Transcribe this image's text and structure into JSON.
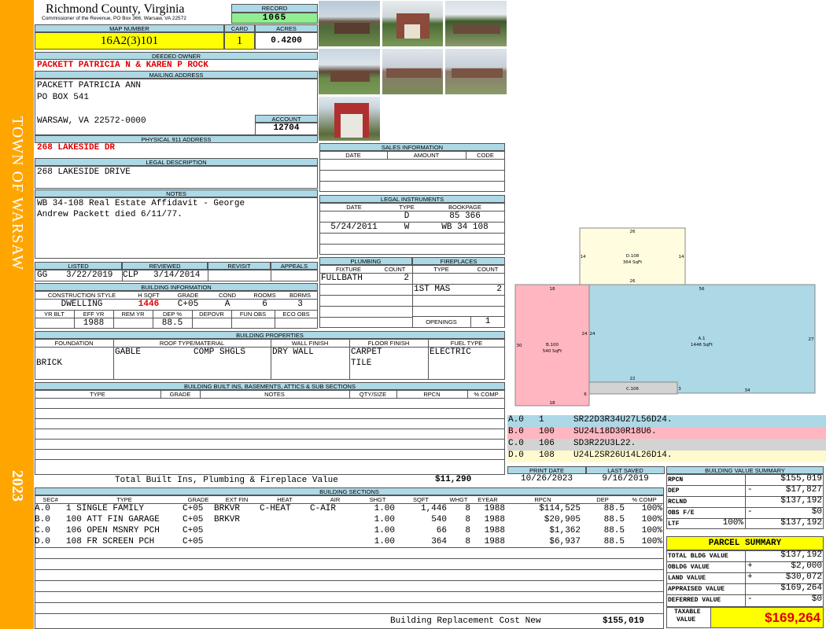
{
  "side": {
    "town": "TOWN OF WARSAW",
    "year": "2023"
  },
  "header": {
    "county": "Richmond County, Virginia",
    "address": "Commissioner of the Revenue, PO Box 366, Warsaw, VA 22572",
    "record_label": "RECORD",
    "record": "1065",
    "map_label": "MAP NUMBER",
    "map": "16A2(3)101",
    "card_label": "CARD",
    "card": "1",
    "acres_label": "ACRES",
    "acres": "0.4200"
  },
  "owner": {
    "deeded_label": "DEEDED OWNER",
    "deeded": "PACKETT PATRICIA N & KAREN P ROCK",
    "mailing_label": "MAILING ADDRESS",
    "mail1": "PACKETT PATRICIA ANN",
    "mail2": "PO BOX 541",
    "mail3": "WARSAW, VA 22572-0000",
    "account_label": "ACCOUNT",
    "account": "12704",
    "physical_label": "PHYSICAL 911 ADDRESS",
    "physical": "268 LAKESIDE DR",
    "legal_label": "LEGAL DESCRIPTION",
    "legal": "268 LAKESIDE DRIVE",
    "notes_label": "NOTES",
    "notes1": "WB 34-108 Real Estate Affidavit - George",
    "notes2": "Andrew Packett died 6/11/77."
  },
  "sales": {
    "title": "SALES INFORMATION",
    "date": "DATE",
    "amount": "AMOUNT",
    "code": "CODE"
  },
  "legal_instr": {
    "title": "LEGAL INSTRUMENTS",
    "date": "DATE",
    "type": "TYPE",
    "bookpage": "BOOKPAGE",
    "rows": [
      {
        "date": "",
        "type": "D",
        "bookpage": "85 366"
      },
      {
        "date": "5/24/2011",
        "type": "W",
        "bookpage": "WB 34 108"
      }
    ]
  },
  "listed": {
    "listed_label": "LISTED",
    "reviewed_label": "REVIEWED",
    "revisit_label": "REVISIT",
    "appeals_label": "APPEALS",
    "listed_by": "GG",
    "listed_date": "3/22/2019",
    "reviewed_by": "CLP",
    "reviewed_date": "3/14/2014"
  },
  "building_info": {
    "title": "BUILDING INFORMATION",
    "h1": "CONSTRUCTION STYLE",
    "h2": "H SQFT",
    "h3": "GRADE",
    "h4": "COND",
    "h5": "ROOMS",
    "h6": "BDRMS",
    "style": "DWELLING",
    "hsqft": "1446",
    "grade": "C+05",
    "cond": "A",
    "rooms": "6",
    "bdrms": "3",
    "g1": "YR BLT",
    "g2": "EFF YR",
    "g3": "REM YR",
    "g4": "DEP %",
    "g5": "DEPOVR",
    "g6": "FUN OBS",
    "g7": "ECO OBS",
    "effyr": "1988",
    "dep": "88.5"
  },
  "plumbing": {
    "title": "PLUMBING",
    "fixture": "FIXTURE",
    "count": "COUNT",
    "item": "FULLBATH",
    "n": "2"
  },
  "fireplaces": {
    "title": "FIREPLACES",
    "type": "TYPE",
    "count": "COUNT",
    "item": "1ST MAS",
    "n": "2",
    "openings_label": "OPENINGS",
    "openings": "1"
  },
  "properties": {
    "title": "BUILDING PROPERTIES",
    "foundation_label": "FOUNDATION",
    "roof_label": "ROOF TYPE/MATERIAL",
    "wall_label": "WALL FINISH",
    "floor_label": "FLOOR FINISH",
    "fuel_label": "FUEL TYPE",
    "foundation": "BRICK",
    "roof1": "GABLE",
    "roof2": "COMP SHGLS",
    "wall": "DRY WALL",
    "floor1": "CARPET",
    "floor2": "TILE",
    "fuel": "ELECTRIC"
  },
  "builtins": {
    "title": "BUILDING BUILT INS, BASEMENTS, ATTICS & SUB SECTIONS",
    "type": "TYPE",
    "grade": "GRADE",
    "notes": "NOTES",
    "qty": "QTY/SIZE",
    "rpcn": "RPCN",
    "comp": "% COMP",
    "total_label": "Total Built Ins, Plumbing & Fireplace Value",
    "total": "$11,290"
  },
  "dates": {
    "print_label": "PRINT DATE",
    "print": "10/26/2023",
    "saved_label": "LAST SAVED",
    "saved": "9/16/2019"
  },
  "sketch_codes": [
    {
      "code": "A.0",
      "num": "1",
      "text": "SR22D3R34U27L56D24.",
      "color": "#add8e6"
    },
    {
      "code": "B.0",
      "num": "100",
      "text": "SU24L18D30R18U6.",
      "color": "#ffb6c1"
    },
    {
      "code": "C.0",
      "num": "106",
      "text": "SD3R22U3L22.",
      "color": "#d3d3d3"
    },
    {
      "code": "D.0",
      "num": "108",
      "text": "U24L2SR26U14L26D14.",
      "color": "#fffacd"
    }
  ],
  "sketch": {
    "a_label": "A.1",
    "a_area": "1446 SqFt",
    "b_label": "B.100",
    "b_area": "540 SqFt",
    "c_label": "C.106",
    "d_label": "D.108",
    "d_area": "364 SqFt",
    "dims": [
      "26",
      "14",
      "14",
      "26",
      "18",
      "56",
      "24",
      "24",
      "30",
      "27",
      "22",
      "3",
      "34",
      "6",
      "18"
    ]
  },
  "sections": {
    "title": "BUILDING SECTIONS",
    "headers": [
      "SEC#",
      "TYPE",
      "GRADE",
      "EXT FIN",
      "HEAT",
      "AIR",
      "SHGT",
      "SQFT",
      "WHGT",
      "EYEAR",
      "RPCN",
      "DEP",
      "% COMP"
    ],
    "rows": [
      {
        "sec": "A.0",
        "type": "1 SINGLE FAMILY",
        "grade": "C+05",
        "ext": "BRKVR",
        "heat": "C-HEAT",
        "air": "C-AIR",
        "shgt": "1.00",
        "sqft": "1,446",
        "whgt": "8",
        "eyear": "1988",
        "rpcn": "$114,525",
        "dep": "88.5",
        "comp": "100%"
      },
      {
        "sec": "B.0",
        "type": "100 ATT FIN GARAGE",
        "grade": "C+05",
        "ext": "BRKVR",
        "heat": "",
        "air": "",
        "shgt": "1.00",
        "sqft": "540",
        "whgt": "8",
        "eyear": "1988",
        "rpcn": "$20,905",
        "dep": "88.5",
        "comp": "100%"
      },
      {
        "sec": "C.0",
        "type": "106 OPEN MSNRY PCH",
        "grade": "C+05",
        "ext": "",
        "heat": "",
        "air": "",
        "shgt": "1.00",
        "sqft": "66",
        "whgt": "8",
        "eyear": "1988",
        "rpcn": "$1,362",
        "dep": "88.5",
        "comp": "100%"
      },
      {
        "sec": "D.0",
        "type": "108 FR SCREEN PCH",
        "grade": "C+05",
        "ext": "",
        "heat": "",
        "air": "",
        "shgt": "1.00",
        "sqft": "364",
        "whgt": "8",
        "eyear": "1988",
        "rpcn": "$6,937",
        "dep": "88.5",
        "comp": "100%"
      }
    ],
    "replacement_label": "Building Replacement Cost New",
    "replacement": "$155,019"
  },
  "value_summary": {
    "title": "BUILDING VALUE SUMMARY",
    "rows": [
      {
        "label": "RPCN",
        "sign": "",
        "pct": "",
        "value": "$155,019"
      },
      {
        "label": "DEP",
        "sign": "-",
        "pct": "",
        "value": "$17,827"
      },
      {
        "label": "RCLND",
        "sign": "",
        "pct": "",
        "value": "$137,192"
      },
      {
        "label": "OBS F/E",
        "sign": "-",
        "pct": "",
        "value": "$0"
      },
      {
        "label": "LTF",
        "sign": "",
        "pct": "100%",
        "value": "$137,192"
      }
    ]
  },
  "parcel": {
    "title": "PARCEL SUMMARY",
    "rows": [
      {
        "label": "TOTAL BLDG VALUE",
        "sign": "",
        "value": "$137,192"
      },
      {
        "label": "OBLDG VALUE",
        "sign": "+",
        "value": "$2,000"
      },
      {
        "label": "LAND VALUE",
        "sign": "+",
        "value": "$30,072"
      },
      {
        "label": "APPRAISED VALUE",
        "sign": "",
        "value": "$169,264"
      },
      {
        "label": "DEFERRED VALUE",
        "sign": "-",
        "value": "$0"
      }
    ],
    "taxable_label1": "TAXABLE",
    "taxable_label2": "VALUE",
    "taxable": "$169,264"
  }
}
